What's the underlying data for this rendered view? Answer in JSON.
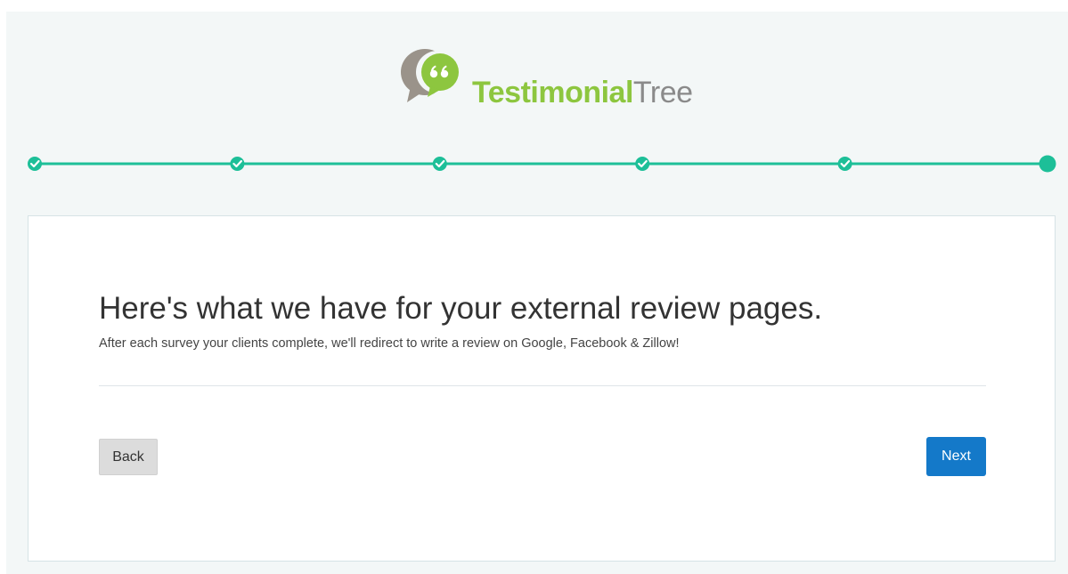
{
  "brand": {
    "name_part1": "Testimonial",
    "name_part2": "Tree",
    "logo_icon": "quote-bubble-logo-icon",
    "colors": {
      "green": "#8dc63f",
      "gray": "#8a8a8a"
    }
  },
  "progress": {
    "total_steps": 6,
    "completed_steps": 5,
    "current_step": 6,
    "step_icon_completed": "check-icon",
    "color": "#1dbf98"
  },
  "content": {
    "title": "Here's what we have for your external review pages.",
    "subtitle": "After each survey your clients complete, we'll redirect to write a review on Google, Facebook & Zillow!"
  },
  "buttons": {
    "back_label": "Back",
    "next_label": "Next",
    "next_color": "#1479c9"
  }
}
